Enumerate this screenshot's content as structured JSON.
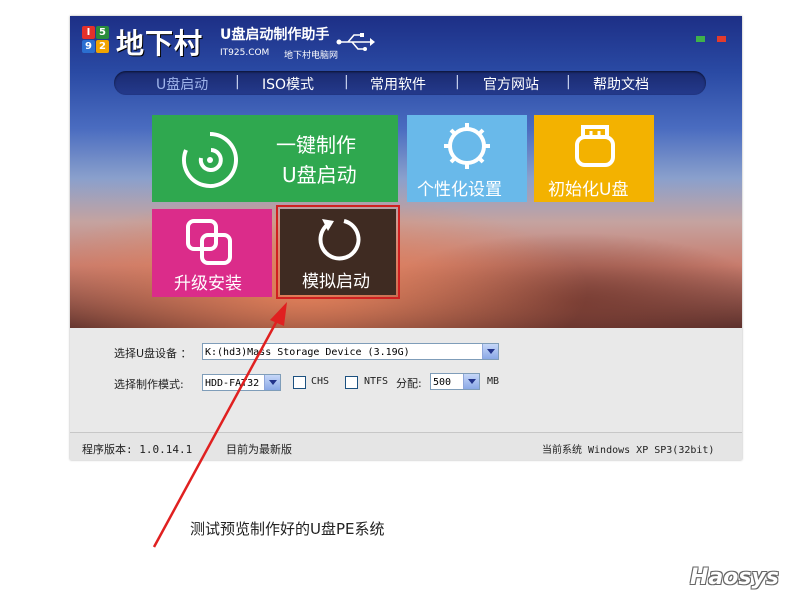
{
  "brand": {
    "logo_digits": [
      "I",
      "5",
      "9",
      "2"
    ],
    "name": "地下村",
    "subtitle": "U盘启动制作助手",
    "site": "IT925.COM",
    "site_cn": "地下村电脑网"
  },
  "nav": {
    "items": [
      {
        "label": "U盘启动",
        "active": true
      },
      {
        "label": "ISO模式"
      },
      {
        "label": "常用软件"
      },
      {
        "label": "官方网站"
      },
      {
        "label": "帮助文档"
      }
    ],
    "separator": "|"
  },
  "tiles": {
    "one_click": {
      "line1": "一键制作",
      "line2": "U盘启动",
      "color": "#2fa84f",
      "icon": "disc-icon"
    },
    "personalize": {
      "label": "个性化设置",
      "color": "#69b9ea",
      "icon": "gear-icon"
    },
    "init": {
      "label": "初始化U盘",
      "color": "#f3b200",
      "icon": "usb-drive-icon"
    },
    "upgrade": {
      "label": "升级安装",
      "color": "#db2c8a",
      "icon": "overlap-squares-icon"
    },
    "simulate": {
      "label": "模拟启动",
      "color": "#3f2b22",
      "icon": "refresh-icon",
      "highlight": "#d02020"
    }
  },
  "form": {
    "device_label": "选择U盘设备 ：",
    "device_value": "K:(hd3)Mass Storage Device (3.19G)",
    "mode_label": "选择制作模式:",
    "mode_value": "HDD-FAT32",
    "chs_label": "CHS",
    "ntfs_label": "NTFS",
    "alloc_label": "分配:",
    "alloc_value": "500",
    "alloc_unit": "MB"
  },
  "status": {
    "version": "程序版本: 1.0.14.1",
    "update": "目前为最新版",
    "system": "当前系统 Windows XP SP3(32bit)"
  },
  "annotation": {
    "caption": "测试预览制作好的U盘PE系统",
    "arrow_color": "#e02020"
  },
  "watermark": "Haosys"
}
